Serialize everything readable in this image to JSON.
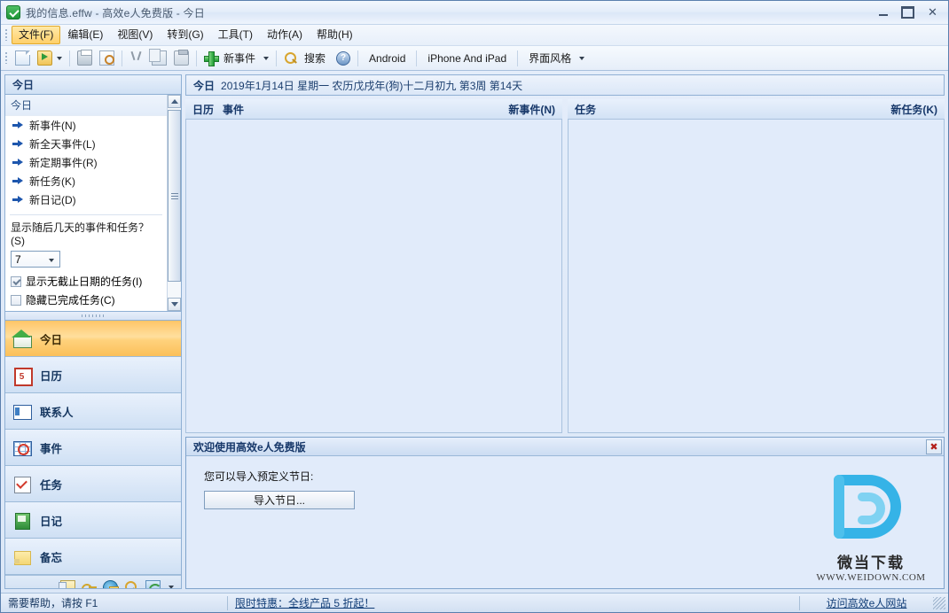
{
  "window": {
    "title": "我的信息.effw - 高效e人免费版 - 今日",
    "app_icon": "check-circle-icon",
    "minimize_label": "",
    "maximize_label": "",
    "close_label": "✕"
  },
  "menubar": {
    "items": [
      {
        "label": "文件(F)",
        "active": true
      },
      {
        "label": "编辑(E)",
        "active": false
      },
      {
        "label": "视图(V)",
        "active": false
      },
      {
        "label": "转到(G)",
        "active": false
      },
      {
        "label": "工具(T)",
        "active": false
      },
      {
        "label": "动作(A)",
        "active": false
      },
      {
        "label": "帮助(H)",
        "active": false
      }
    ]
  },
  "toolbar": {
    "new_file": "new-document-icon",
    "open_file": "open-folder-icon",
    "print": "print-icon",
    "print_preview": "print-preview-icon",
    "cut": "cut-icon",
    "copy": "copy-icon",
    "paste": "paste-icon",
    "new_event_label": "新事件",
    "search_label": "搜索",
    "help_glyph": "?",
    "android_label": "Android",
    "iphone_label": "iPhone And iPad",
    "skin_label": "界面风格"
  },
  "sidebar": {
    "panel_title": "今日",
    "section_title": "今日",
    "links": [
      {
        "label": "新事件(N)"
      },
      {
        "label": "新全天事件(L)"
      },
      {
        "label": "新定期事件(R)"
      },
      {
        "label": "新任务(K)"
      },
      {
        "label": "新日记(D)"
      }
    ],
    "option_label": "显示随后几天的事件和任务？(S)",
    "days_value": "7",
    "checkboxes": [
      {
        "label": "显示无截止日期的任务(I)",
        "checked": true
      },
      {
        "label": "隐藏已完成任务(C)",
        "checked": false
      }
    ],
    "nav_items": [
      {
        "label": "今日",
        "icon": "home-icon",
        "selected": true
      },
      {
        "label": "日历",
        "icon": "calendar-icon",
        "selected": false
      },
      {
        "label": "联系人",
        "icon": "contacts-icon",
        "selected": false
      },
      {
        "label": "事件",
        "icon": "event-icon",
        "selected": false
      },
      {
        "label": "任务",
        "icon": "task-icon",
        "selected": false
      },
      {
        "label": "日记",
        "icon": "journal-icon",
        "selected": false
      },
      {
        "label": "备忘",
        "icon": "note-icon",
        "selected": false
      }
    ],
    "tool_icons": [
      "clipboard-icon",
      "key-icon",
      "globe-lock-icon",
      "magnifier-icon",
      "sync-icon",
      "chevron-down-icon"
    ]
  },
  "main": {
    "date_prefix": "今日",
    "date_text": "2019年1月14日  星期一  农历戊戌年(狗)十二月初九  第3周 第14天",
    "calendar_pane": {
      "label_calendar": "日历",
      "label_events": "事件",
      "action": "新事件(N)"
    },
    "task_pane": {
      "label_tasks": "任务",
      "action": "新任务(K)"
    }
  },
  "welcome": {
    "title": "欢迎使用高效e人免费版",
    "close": "✖",
    "text": "您可以导入预定义节日:",
    "button": "导入节日...",
    "watermark_name": "微当下载",
    "watermark_url": "WWW.WEIDOWN.COM",
    "watermark_logo": "letter-d-logo"
  },
  "statusbar": {
    "help_text": "需要帮助，请按 F1",
    "promo_text": "限时特惠：全线产品 5 折起！",
    "site_link": "访问高效e人网站"
  },
  "colors": {
    "accent_blue": "#17386a",
    "selected_orange": "#ffc568",
    "panel_bg": "#e1ebfa",
    "border_blue": "#8fb0d4",
    "logo_blue": "#29a9e0"
  }
}
